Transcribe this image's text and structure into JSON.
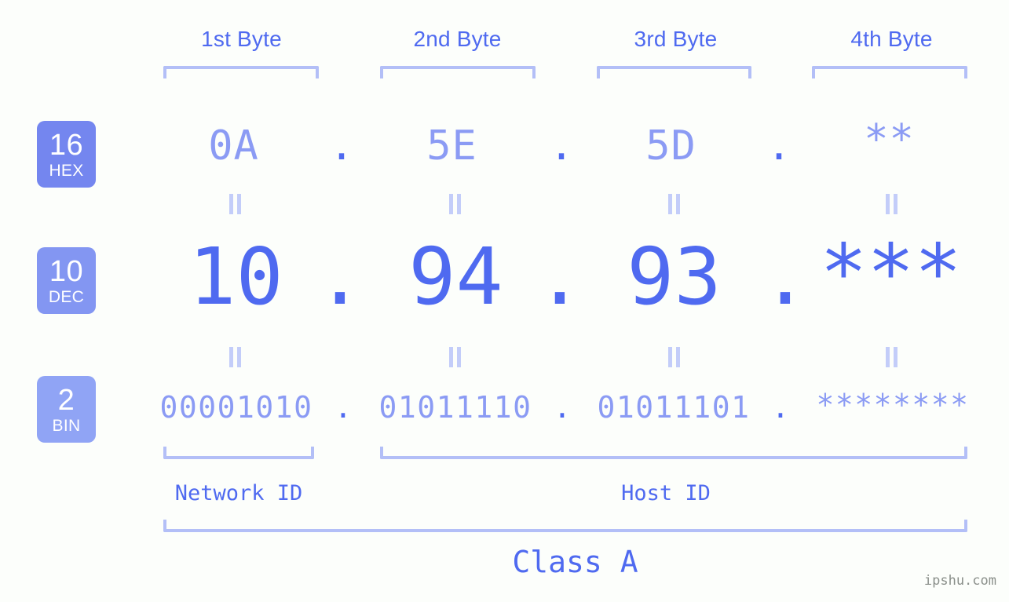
{
  "background_color": "#fcfefb",
  "accent_color": "#4f6af0",
  "accent_light_color": "#8b9bf4",
  "bracket_color": "#b3bff7",
  "byte_headers": [
    {
      "label": "1st Byte"
    },
    {
      "label": "2nd Byte"
    },
    {
      "label": "3rd Byte"
    },
    {
      "label": "4th Byte"
    }
  ],
  "rows": [
    {
      "badge_number": "16",
      "badge_tag": "HEX",
      "badge_color": "#7486ef",
      "values": [
        "0A",
        "5E",
        "5D",
        "**"
      ],
      "separator": "."
    },
    {
      "badge_number": "10",
      "badge_tag": "DEC",
      "badge_color": "#8396f2",
      "values": [
        "10",
        "94",
        "93",
        "***"
      ],
      "separator": "."
    },
    {
      "badge_number": "2",
      "badge_tag": "BIN",
      "badge_color": "#90a4f5",
      "values": [
        "00001010",
        "01011110",
        "01011101",
        "********"
      ],
      "separator": "."
    }
  ],
  "equals_symbol": "||",
  "id_sections": [
    {
      "label": "Network ID"
    },
    {
      "label": "Host ID"
    }
  ],
  "class_label": "Class A",
  "watermark": "ipshu.com"
}
